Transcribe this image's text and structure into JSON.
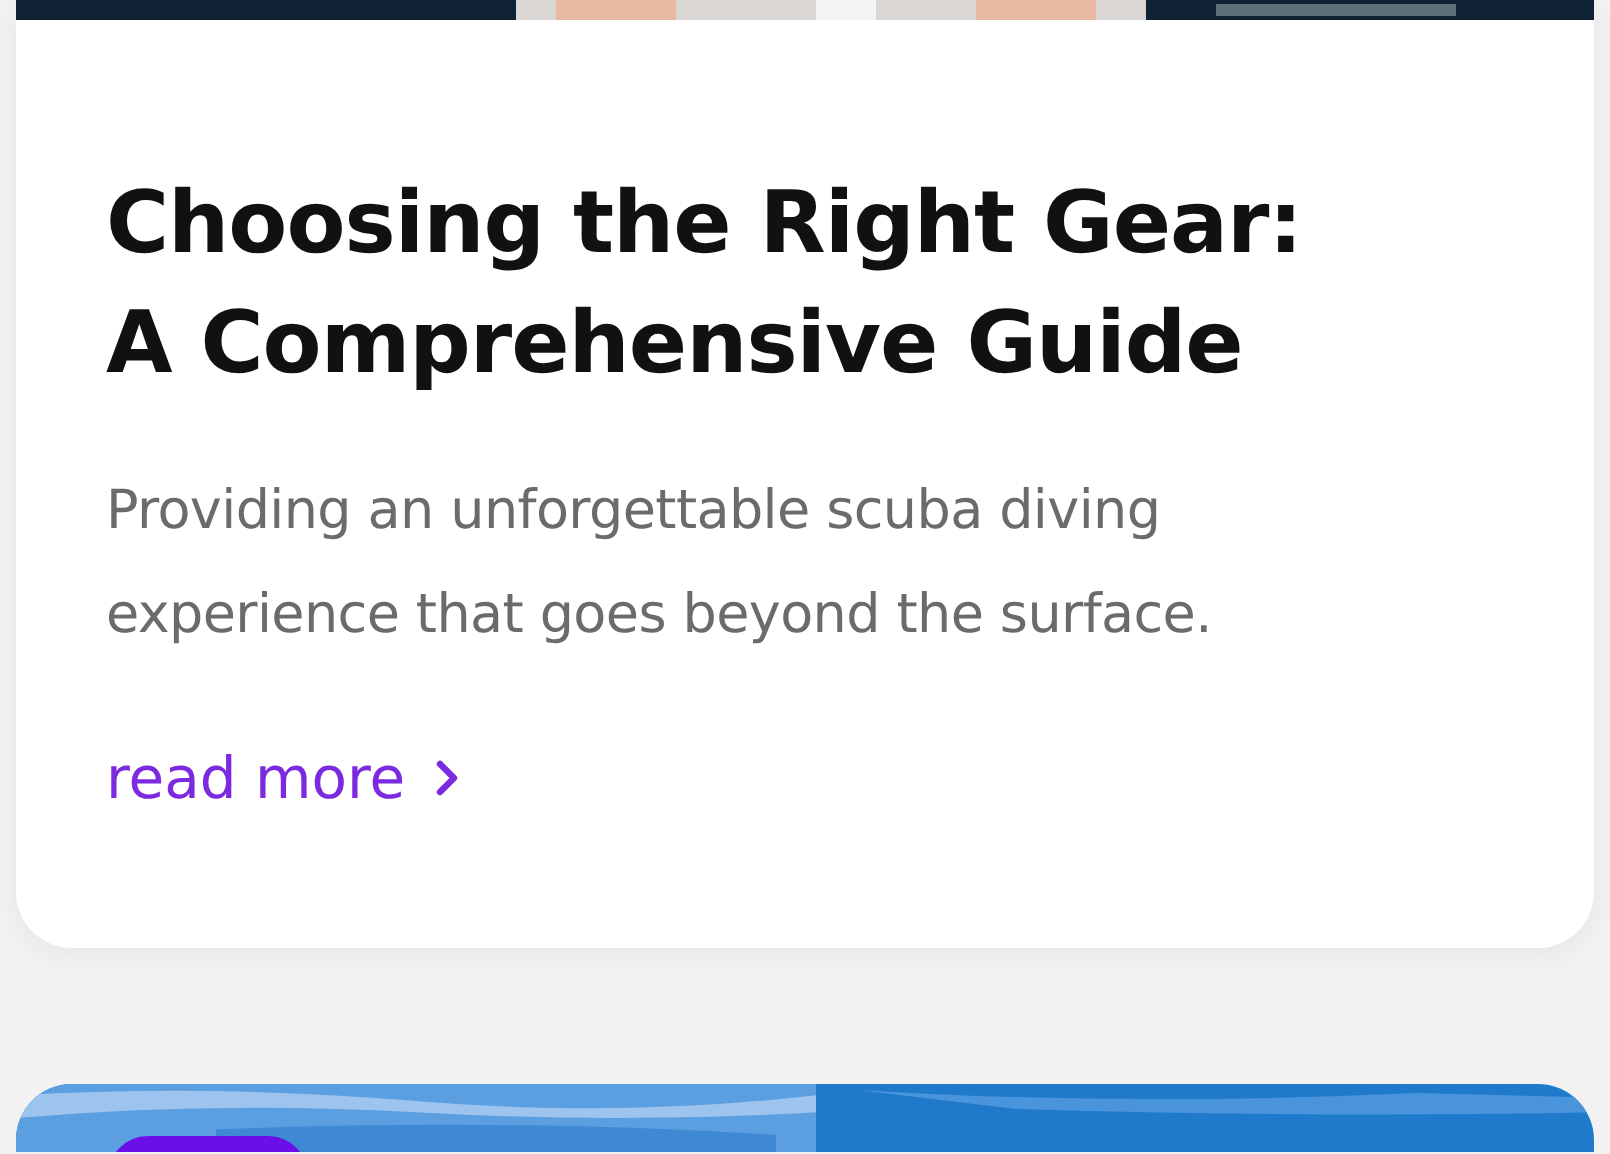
{
  "cards": [
    {
      "kind": "article",
      "title": "Choosing the Right Gear: A Comprehensive Guide",
      "description": "Providing an unforgettable scuba diving experience that goes beyond the surface.",
      "link": "read more"
    },
    {
      "kind": "preview"
    }
  ]
}
